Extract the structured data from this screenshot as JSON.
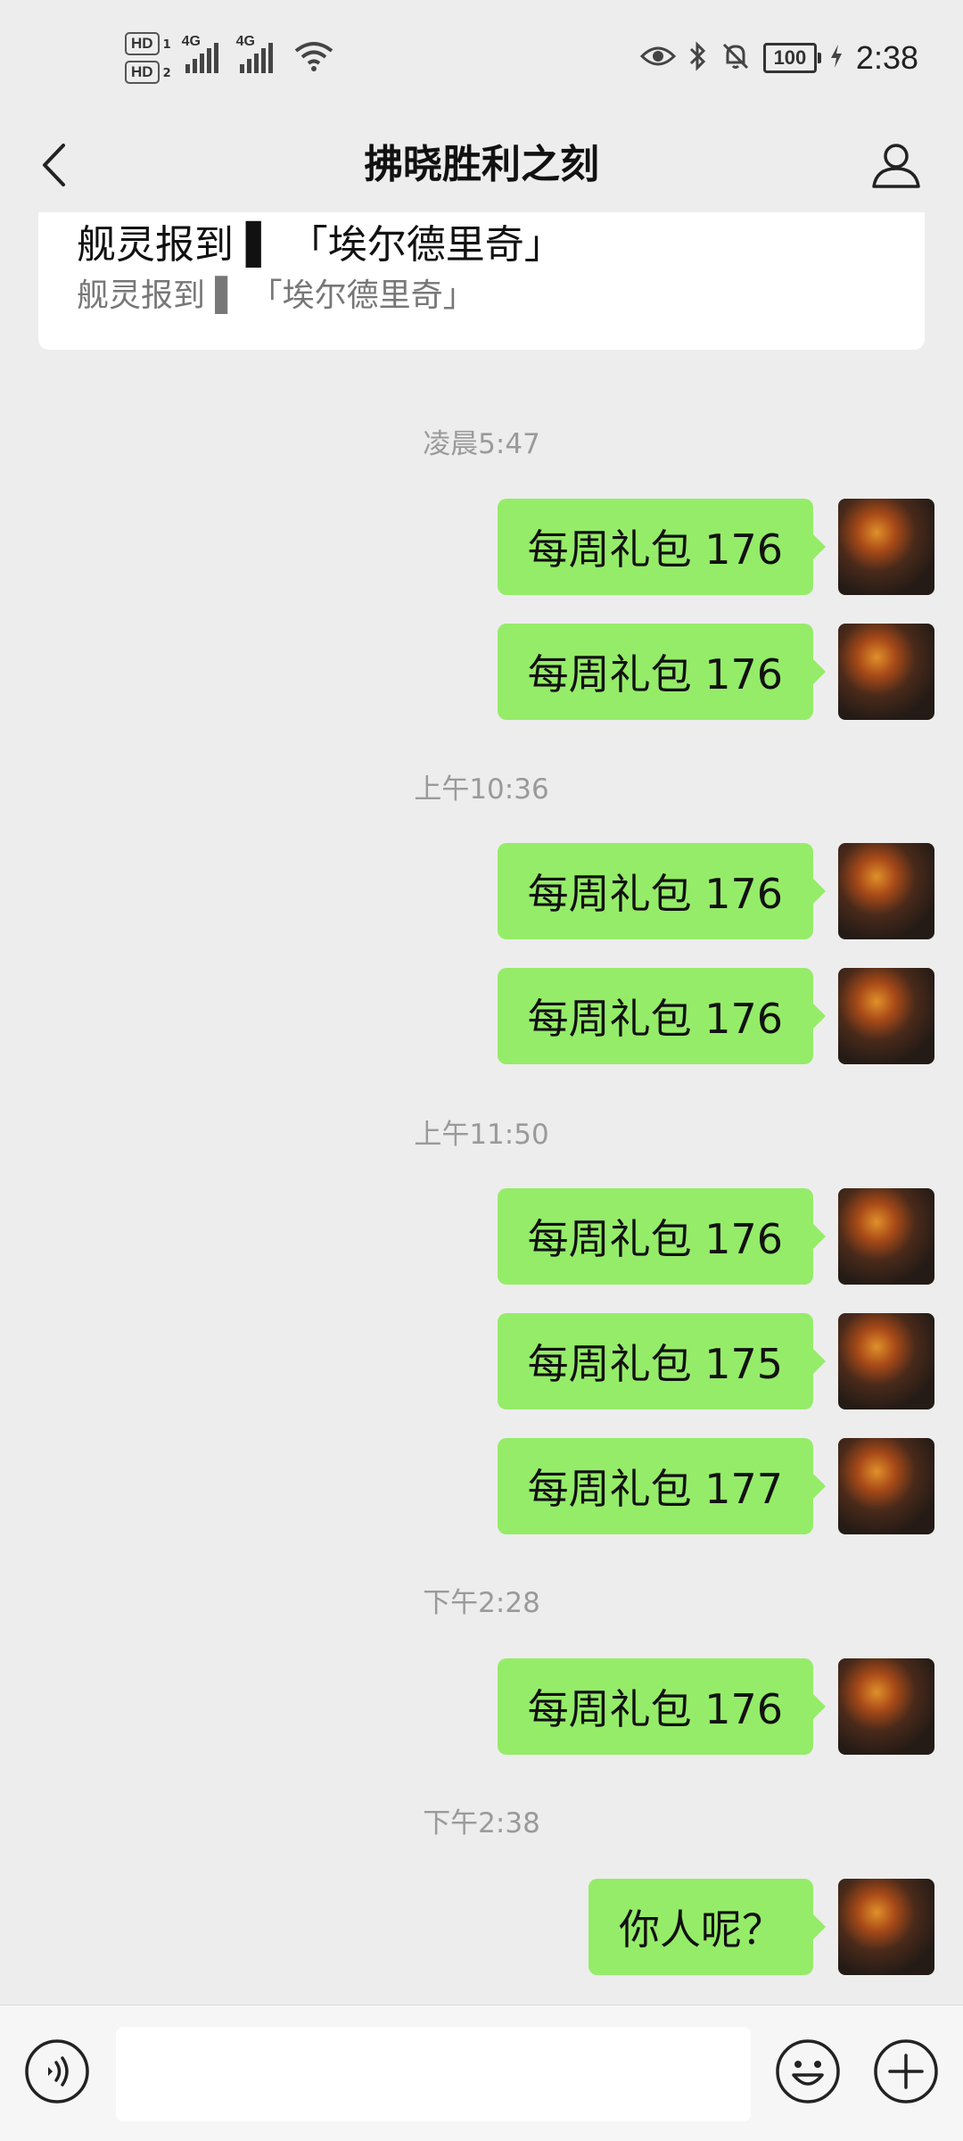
{
  "status_bar": {
    "sim1_label": "HD",
    "sim1_num": "1",
    "sim2_label": "HD",
    "sim2_num": "2",
    "net1": "4G",
    "net2": "4G",
    "battery": "100",
    "time": "2:38",
    "icons": [
      "eye-icon",
      "bluetooth-icon",
      "mute-bell-icon",
      "charging-icon",
      "wifi-icon"
    ]
  },
  "header": {
    "title": "拂晓胜利之刻",
    "back_icon": "chevron-left-icon",
    "profile_icon": "person-icon"
  },
  "pinned": {
    "title": "舰灵报到 ▌ 「埃尔德里奇」",
    "subtitle": "舰灵报到 ▌ 「埃尔德里奇」"
  },
  "chat": {
    "timestamps": [
      "凌晨5:47",
      "上午10:36",
      "上午11:50",
      "下午2:28",
      "下午2:38"
    ],
    "messages": [
      {
        "text": "每周礼包 176"
      },
      {
        "text": "每周礼包 176"
      },
      {
        "text": "每周礼包 176"
      },
      {
        "text": "每周礼包 176"
      },
      {
        "text": "每周礼包 176"
      },
      {
        "text": "每周礼包 175"
      },
      {
        "text": "每周礼包 177"
      },
      {
        "text": "每周礼包 176"
      },
      {
        "text": "你人呢？"
      }
    ]
  },
  "input_bar": {
    "value": "",
    "placeholder": "",
    "icons": [
      "voice-icon",
      "emoji-icon",
      "plus-icon"
    ]
  },
  "colors": {
    "background": "#ededed",
    "bubble_outgoing": "#95ec69",
    "timestamp_text": "#9a9a9a"
  }
}
